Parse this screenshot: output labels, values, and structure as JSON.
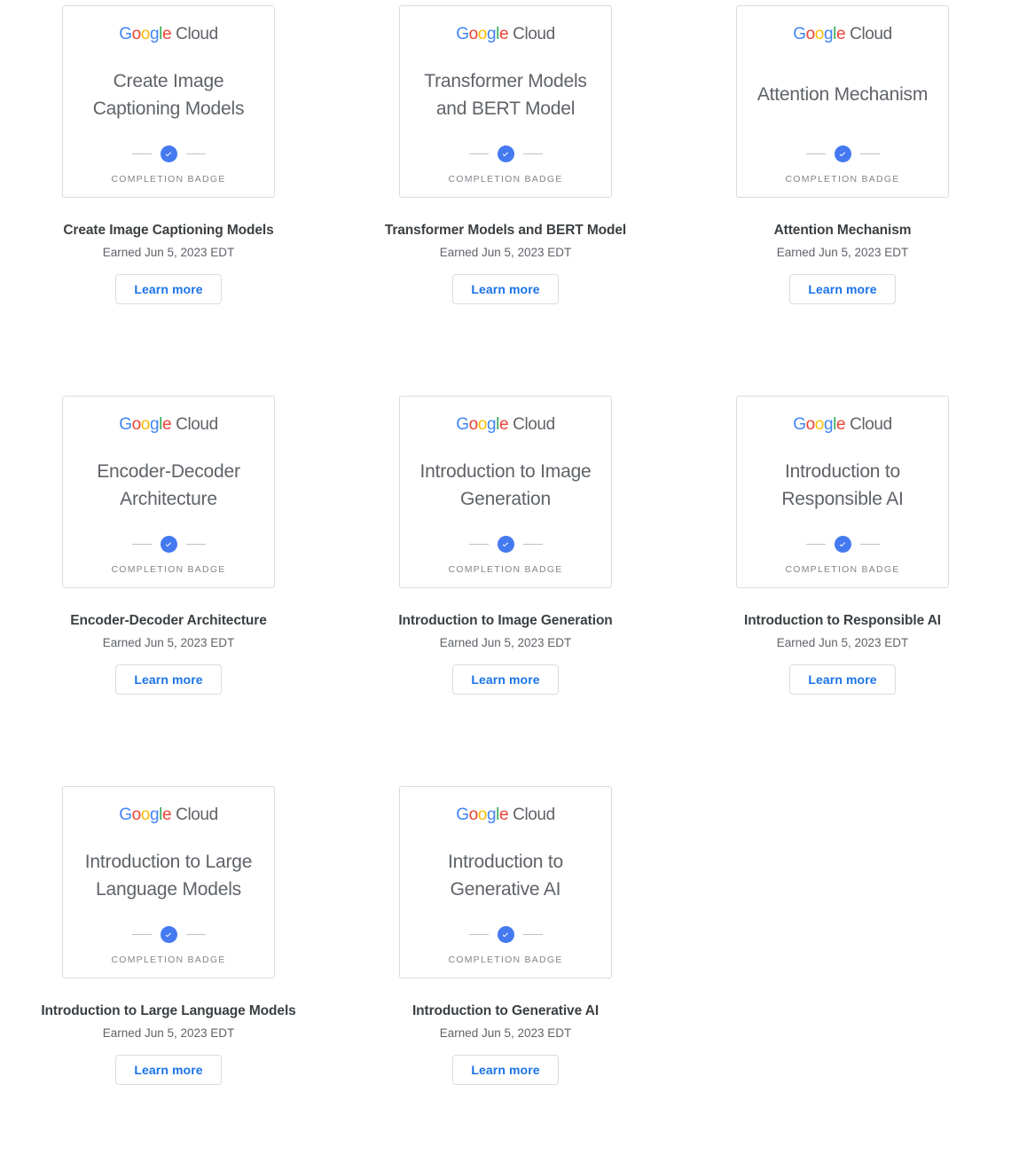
{
  "logo": {
    "google_letters": [
      {
        "char": "G",
        "color": "#4285f4"
      },
      {
        "char": "o",
        "color": "#ea4335"
      },
      {
        "char": "o",
        "color": "#fbbc05"
      },
      {
        "char": "g",
        "color": "#4285f4"
      },
      {
        "char": "l",
        "color": "#34a853"
      },
      {
        "char": "e",
        "color": "#ea4335"
      }
    ],
    "cloud_text": "Cloud"
  },
  "common": {
    "completion_caption": "COMPLETION BADGE",
    "learn_more_label": "Learn more",
    "accent_blue": "#1a73e8",
    "check_circle_color": "#4479f0"
  },
  "badges": [
    {
      "badge_art_title": "Create Image Captioning Models",
      "caption": "COMPLETION BADGE",
      "name": "Create Image Captioning Models",
      "earned": "Earned Jun 5, 2023 EDT",
      "learn_more": "Learn more"
    },
    {
      "badge_art_title": "Transformer Models and BERT Model",
      "caption": "COMPLETION BADGE",
      "name": "Transformer Models and BERT Model",
      "earned": "Earned Jun 5, 2023 EDT",
      "learn_more": "Learn more"
    },
    {
      "badge_art_title": "Attention Mechanism",
      "caption": "COMPLETION BADGE",
      "name": "Attention Mechanism",
      "earned": "Earned Jun 5, 2023 EDT",
      "learn_more": "Learn more"
    },
    {
      "badge_art_title": "Encoder-Decoder Architecture",
      "caption": "COMPLETION BADGE",
      "name": "Encoder-Decoder Architecture",
      "earned": "Earned Jun 5, 2023 EDT",
      "learn_more": "Learn more"
    },
    {
      "badge_art_title": "Introduction to Image Generation",
      "caption": "COMPLETION BADGE",
      "name": "Introduction to Image Generation",
      "earned": "Earned Jun 5, 2023 EDT",
      "learn_more": "Learn more"
    },
    {
      "badge_art_title": "Introduction to Responsible AI",
      "caption": "COMPLETION BADGE",
      "name": "Introduction to Responsible AI",
      "earned": "Earned Jun 5, 2023 EDT",
      "learn_more": "Learn more"
    },
    {
      "badge_art_title": "Introduction to Large Language Models",
      "caption": "COMPLETION BADGE",
      "name": "Introduction to Large Language Models",
      "earned": "Earned Jun 5, 2023 EDT",
      "learn_more": "Learn more"
    },
    {
      "badge_art_title": "Introduction to Generative AI",
      "caption": "COMPLETION BADGE",
      "name": "Introduction to Generative AI",
      "earned": "Earned Jun 5, 2023 EDT",
      "learn_more": "Learn more"
    }
  ]
}
